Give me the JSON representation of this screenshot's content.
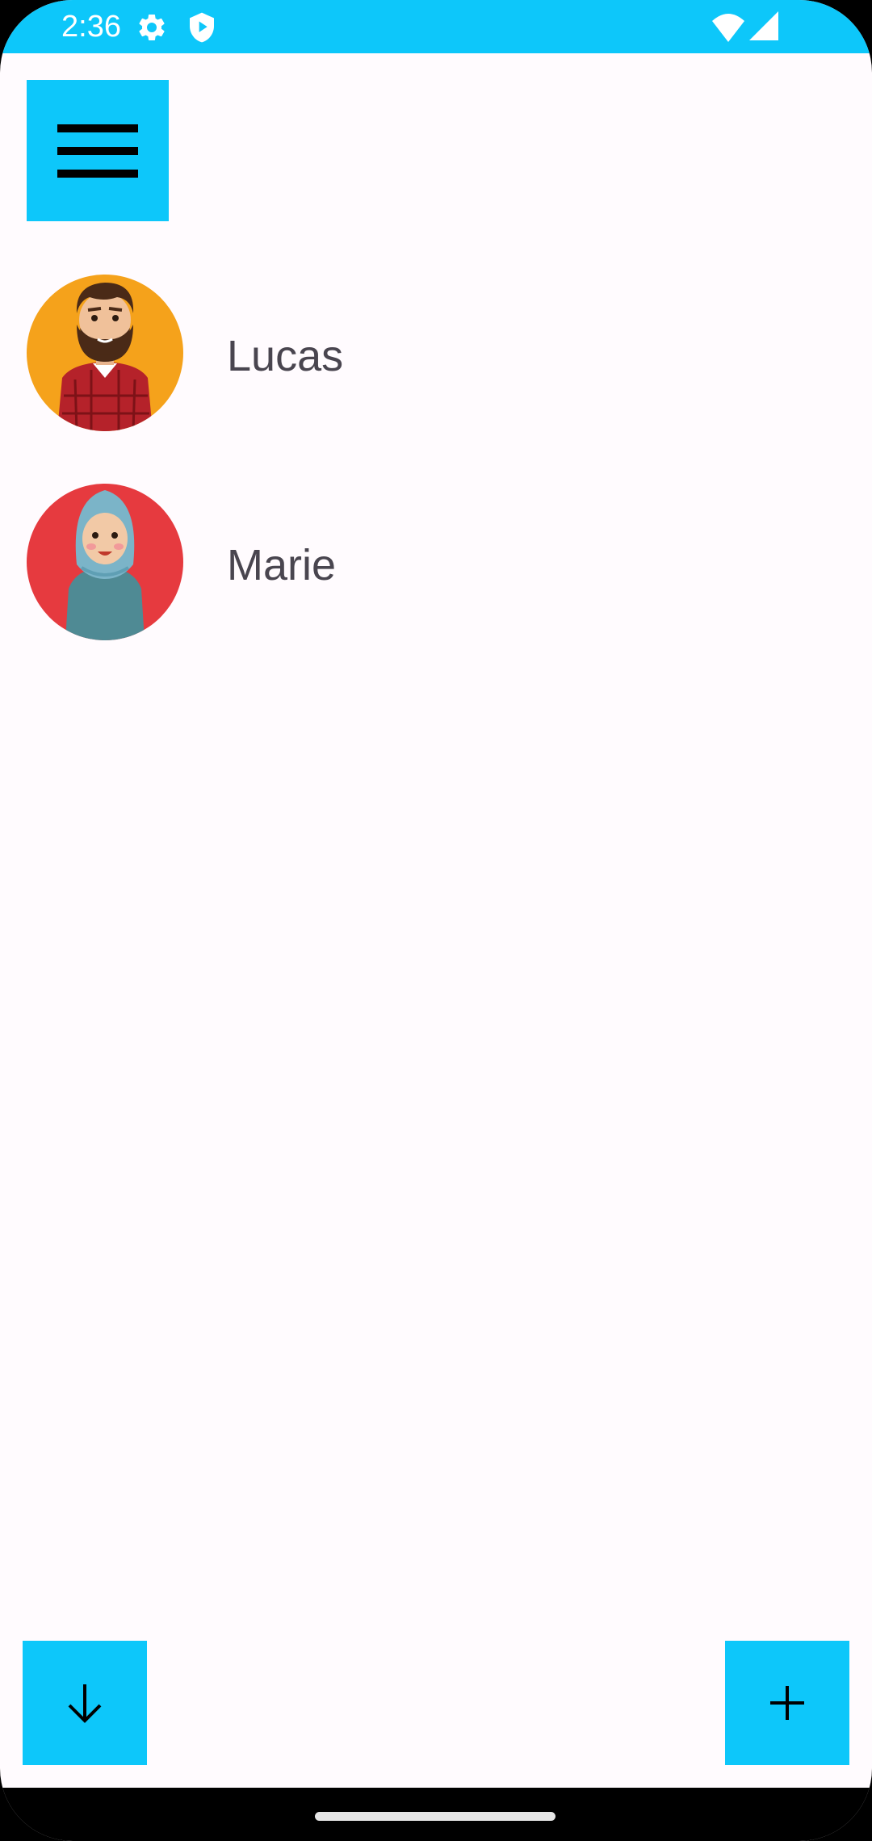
{
  "status_bar": {
    "time": "2:36",
    "icons_left": [
      "settings-icon",
      "shield-play-icon"
    ],
    "icons_right": [
      "wifi-icon",
      "signal-icon"
    ],
    "background": "#0dc7fa"
  },
  "toolbar": {
    "menu_icon": "hamburger-menu-icon"
  },
  "contacts": [
    {
      "name": "Lucas",
      "avatar": "bearded-man-avatar",
      "avatar_bg": "#f5a21b"
    },
    {
      "name": "Marie",
      "avatar": "woman-hijab-avatar",
      "avatar_bg": "#e63a3f"
    }
  ],
  "actions": {
    "left_fab_icon": "arrow-down-icon",
    "right_fab_icon": "plus-icon"
  },
  "colors": {
    "accent": "#0dc7fa",
    "background": "#fffbfe",
    "text": "#49454f"
  }
}
